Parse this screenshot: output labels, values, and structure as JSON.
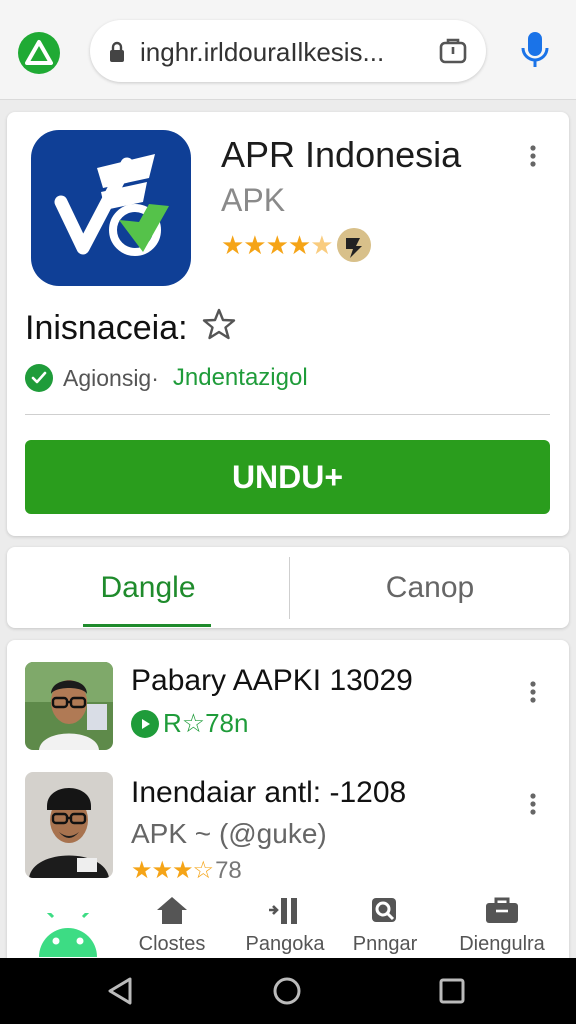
{
  "browser": {
    "url": "inghr.irldouraIlkesis...",
    "logo_icon": "triangle-logo-icon",
    "lock_icon": "lock-icon",
    "tabs_icon": "tabs-icon",
    "mic_icon": "mic-icon"
  },
  "app": {
    "title": "APR Indonesia",
    "subtitle": "APK",
    "rating_stars": "★★★★",
    "rating_value": 4,
    "section_title": "Inisnaceia:",
    "verify_label": "Agionsig·",
    "verify_link": "Jndentazigol",
    "download_label": "UNDU+"
  },
  "tabs": [
    {
      "label": "Dangle",
      "active": true
    },
    {
      "label": "Canop",
      "active": false
    }
  ],
  "list": [
    {
      "title": "Pabary AAPKI 13029",
      "meta": "R☆78n"
    },
    {
      "title": "Inendaiar antl: -1208",
      "subtitle": "APK ~ (@guke)",
      "rating_stars": "★★★☆",
      "rating_count": "78"
    }
  ],
  "bottom_nav": [
    {
      "label": "Clostes",
      "icon": "home-icon"
    },
    {
      "label": "Pangoka",
      "icon": "bars-icon"
    },
    {
      "label": "Pnngar",
      "icon": "search-icon"
    },
    {
      "label": "Diengulra",
      "icon": "briefcase-icon"
    }
  ],
  "colors": {
    "accent_green": "#2a9d1d",
    "app_icon_blue": "#0f3f96",
    "star": "#f5a417"
  }
}
